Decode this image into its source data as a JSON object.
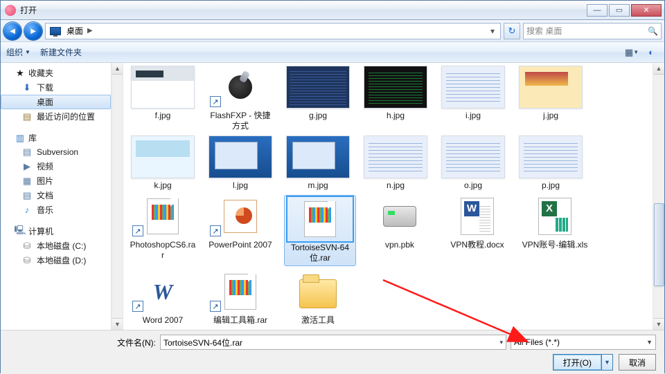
{
  "window": {
    "title": "打开"
  },
  "nav": {
    "location_icon": "monitor",
    "breadcrumb": [
      "桌面"
    ],
    "search_placeholder": "搜索 桌面"
  },
  "toolbar": {
    "organize": "组织",
    "newfolder": "新建文件夹"
  },
  "sidebar": {
    "favorites": {
      "title": "收藏夹",
      "items": [
        "下载",
        "桌面",
        "最近访问的位置"
      ],
      "selected": 1
    },
    "libraries": {
      "title": "库",
      "items": [
        "Subversion",
        "视频",
        "图片",
        "文档",
        "音乐"
      ]
    },
    "computer": {
      "title": "计算机",
      "items": [
        "本地磁盘 (C:)",
        "本地磁盘 (D:)"
      ]
    }
  },
  "files": {
    "row1": [
      {
        "name": "f.jpg",
        "kind": "img-a"
      },
      {
        "name": "FlashFXP - 快捷方式",
        "kind": "rocket",
        "shortcut": true
      },
      {
        "name": "g.jpg",
        "kind": "img-c"
      },
      {
        "name": "h.jpg",
        "kind": "img-d"
      },
      {
        "name": "i.jpg",
        "kind": "img-e"
      },
      {
        "name": "j.jpg",
        "kind": "img-f"
      },
      {
        "name": "k.jpg",
        "kind": "img-g"
      }
    ],
    "row2": [
      {
        "name": "l.jpg",
        "kind": "img-win"
      },
      {
        "name": "m.jpg",
        "kind": "img-win"
      },
      {
        "name": "n.jpg",
        "kind": "img-e"
      },
      {
        "name": "o.jpg",
        "kind": "img-e"
      },
      {
        "name": "p.jpg",
        "kind": "img-e"
      },
      {
        "name": "PhotoshopCS6.rar",
        "kind": "rar",
        "shortcut": true
      },
      {
        "name": "PowerPoint 2007",
        "kind": "ppt",
        "shortcut": true
      }
    ],
    "row3": [
      {
        "name": "TortoiseSVN-64位.rar",
        "kind": "rar",
        "selected": true
      },
      {
        "name": "vpn.pbk",
        "kind": "modem"
      },
      {
        "name": "VPN教程.docx",
        "kind": "docx"
      },
      {
        "name": "VPN账号-编辑.xls",
        "kind": "xls"
      },
      {
        "name": "Word 2007",
        "kind": "word",
        "shortcut": true
      },
      {
        "name": "编辑工具箱.rar",
        "kind": "rar",
        "shortcut": true
      },
      {
        "name": "激活工具",
        "kind": "folder"
      }
    ]
  },
  "bottom": {
    "filename_label": "文件名(N):",
    "filename_value": "TortoiseSVN-64位.rar",
    "filter": "All Files (*.*)",
    "open": "打开(O)",
    "cancel": "取消"
  }
}
